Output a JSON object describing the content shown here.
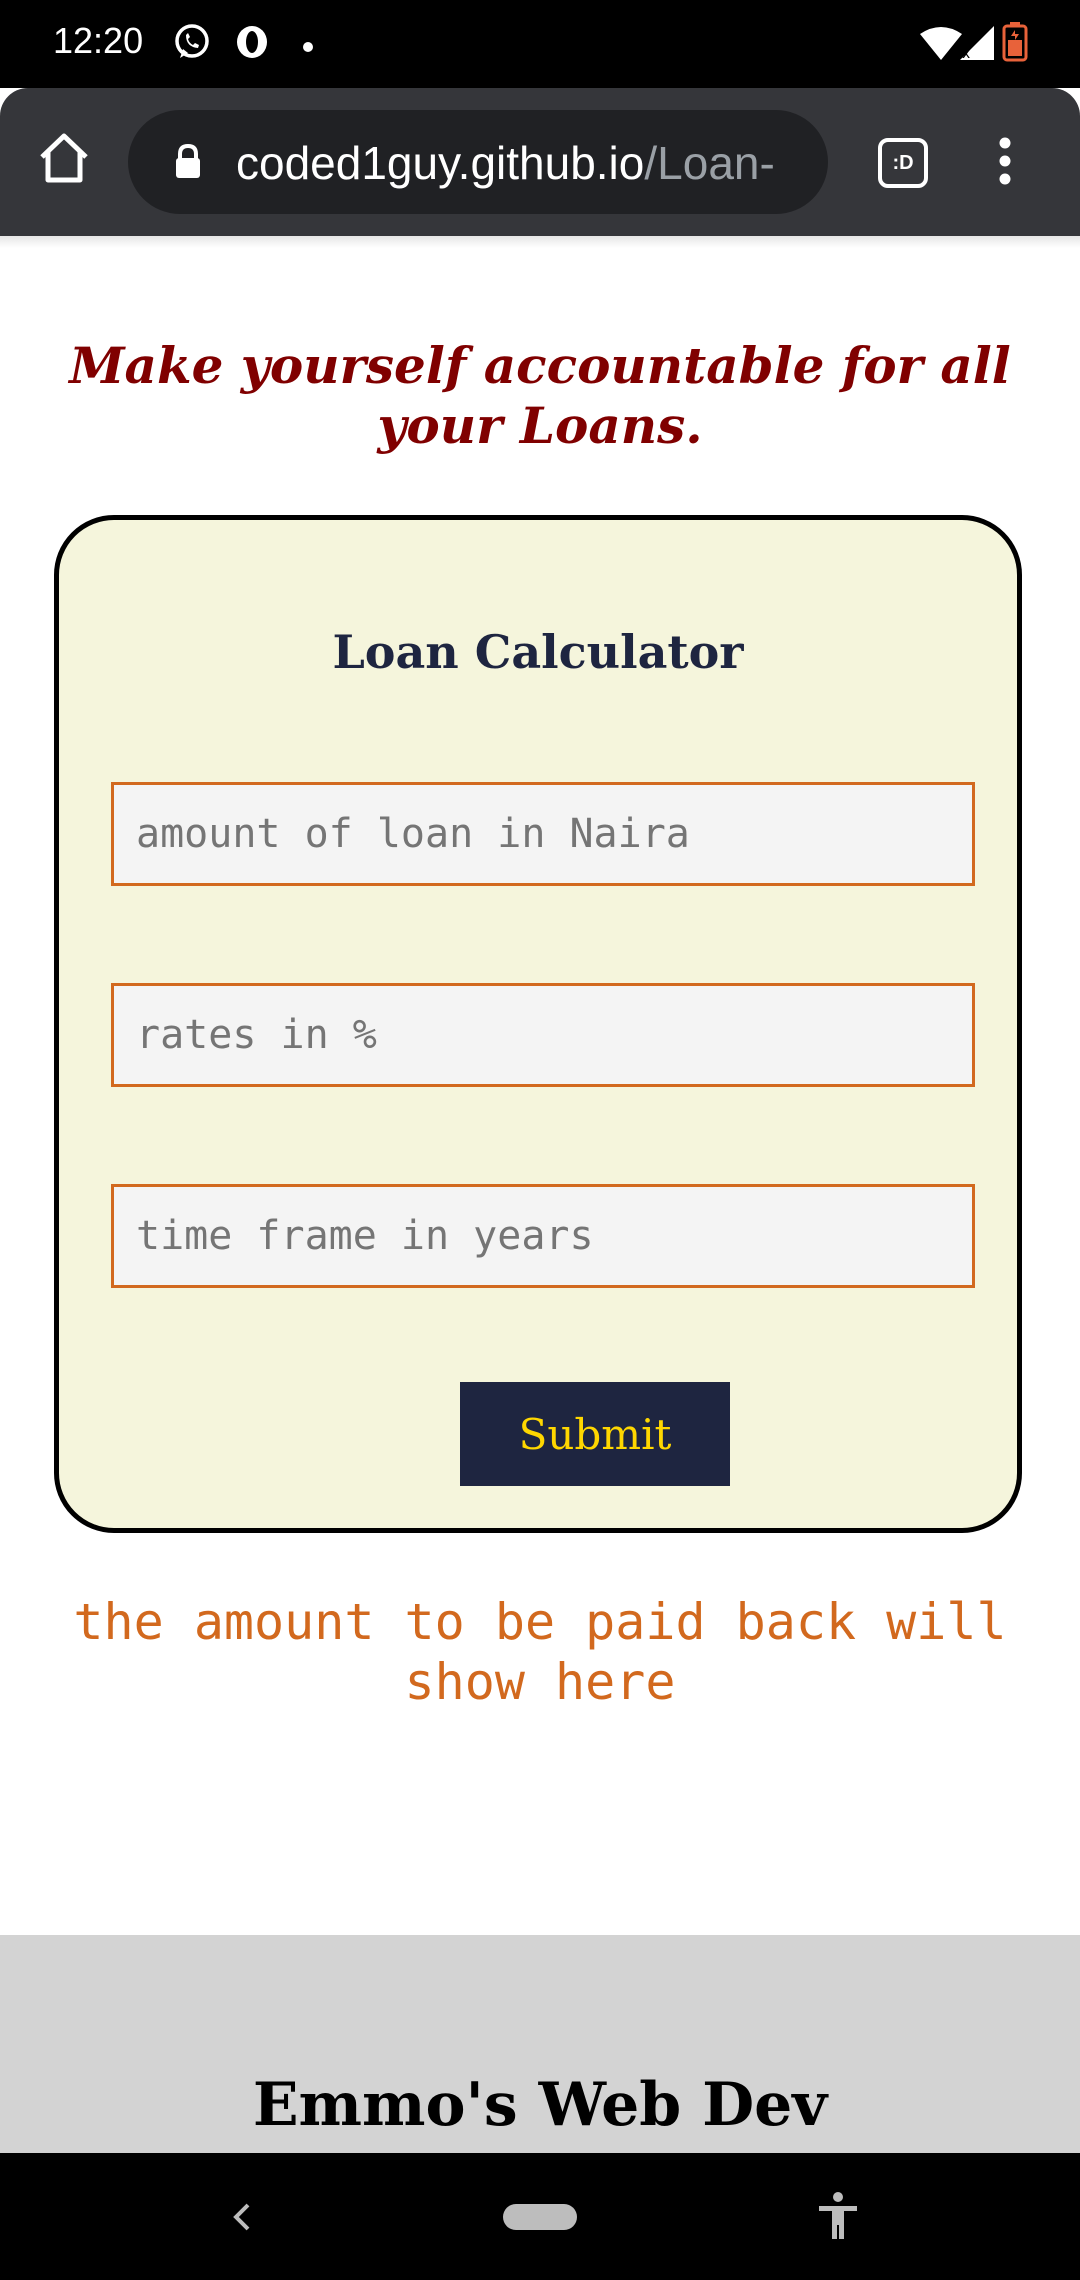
{
  "status_bar": {
    "time": "12:20",
    "icons": [
      "whatsapp-icon",
      "opera-icon",
      "dot-icon",
      "wifi-icon",
      "signal-icon",
      "battery-icon"
    ]
  },
  "browser": {
    "url_domain": "coded1guy.github.io",
    "url_path": "/Loan-",
    "tabs_label": ":D",
    "icons": [
      "home-icon",
      "lock-icon",
      "more-vert-icon"
    ]
  },
  "page": {
    "tagline": "Make yourself accountable for all your Loans.",
    "calculator": {
      "title": "Loan Calculator",
      "amount_placeholder": "amount of loan in Naira",
      "amount_value": "",
      "rate_placeholder": "rates in %",
      "rate_value": "",
      "time_placeholder": "time frame in years",
      "time_value": "",
      "submit_label": "Submit"
    },
    "result_text": "the amount to be paid back will show here",
    "footer_title": "Emmo's Web Dev"
  },
  "colors": {
    "tagline": "#800000",
    "card_bg": "#f5f5dc",
    "field_border": "#d2691e",
    "button_bg": "#1e2540",
    "button_text": "#ffd700",
    "result_text": "#d2691e",
    "footer_bg": "#d3d3d3"
  }
}
